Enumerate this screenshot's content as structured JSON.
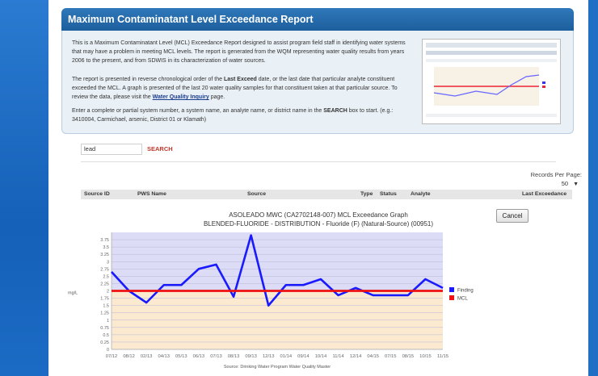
{
  "report": {
    "title": "Maximum Contaminatant Level Exceedance Report",
    "p1": "This is a Maximum Contaminatant Level (MCL) Exceedance Report designed to assist program field staff in identifying water systems that may have a problem in meeting MCL levels.  The report is generated from the WQM representing water quality results from years 2006 to the present, and from SDWIS in its characterization of water sources.",
    "p2a": "The report is presented in reverse chronological order of the ",
    "p2b": "Last Exceed",
    "p2c": " date, or the last date that particular analyte constituent exceeded the MCL.  A graph is presented of the last 20 water quality samples for that constituent taken at that particular source.  To review the data, please visit the ",
    "p2link": "Water Quality Inquiry",
    "p2d": " page.",
    "p3a": "Enter a complete or partial system number, a system name, an analyte name, or district name in the ",
    "p3b": "SEARCH",
    "p3c": " box to start. (e.g.: 3410004, Carmichael, arsenic, District 01 or Klamath)"
  },
  "search": {
    "value": "lead",
    "button": "SEARCH"
  },
  "records_per_page": {
    "label": "Records Per Page:",
    "value": "50"
  },
  "table": {
    "headers": [
      "Source ID",
      "PWS Name",
      "Source",
      "Type",
      "Status",
      "Analyte",
      "Last Exceedance"
    ]
  },
  "graph": {
    "title": "ASOLEADO MWC (CA2702148-007) MCL Exceedance Graph",
    "subtitle": "BLENDED-FLUORIDE - DISTRIBUTION - Fluoride (F) (Natural-Source) (00951)",
    "cancel": "Cancel"
  },
  "chart_data": {
    "type": "line",
    "ylabel": "mg/L",
    "ylim": [
      0,
      4
    ],
    "yticks": [
      "0",
      "0.25",
      "0.5",
      "0.75",
      "1",
      "1.25",
      "1.5",
      "1.75",
      "2",
      "2.25",
      "2.5",
      "2.75",
      "3",
      "3.25",
      "3.5",
      "3.75"
    ],
    "xticks": [
      "07/12",
      "08/12",
      "02/13",
      "04/13",
      "05/13",
      "06/13",
      "07/13",
      "08/13",
      "09/13",
      "12/13",
      "01/14",
      "09/14",
      "10/14",
      "11/14",
      "12/14",
      "04/15",
      "07/15",
      "08/15",
      "10/15",
      "11/15"
    ],
    "series": [
      {
        "name": "Finding",
        "color": "#1a1aff",
        "values": [
          2.65,
          2.0,
          1.6,
          2.2,
          2.2,
          2.75,
          2.9,
          1.8,
          3.9,
          1.5,
          2.2,
          2.2,
          2.4,
          1.85,
          2.1,
          1.85,
          1.85,
          1.85,
          2.4,
          2.1
        ]
      },
      {
        "name": "MCL",
        "color": "#ee1111",
        "values": [
          2,
          2,
          2,
          2,
          2,
          2,
          2,
          2,
          2,
          2,
          2,
          2,
          2,
          2,
          2,
          2,
          2,
          2,
          2,
          2
        ]
      }
    ],
    "source_note": "Source: Drinking Water Program Water Quality Master",
    "colors": {
      "above_fill": "#dcdcf6",
      "below_fill": "#fbead0"
    }
  }
}
